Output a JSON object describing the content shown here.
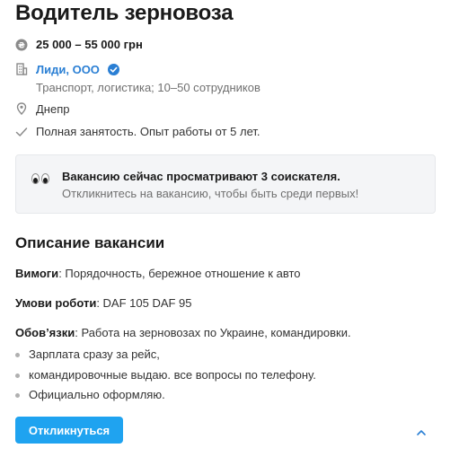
{
  "vacancy": {
    "title": "Водитель зерновоза",
    "salary": "25 000 – 55 000 грн",
    "company_name": "Лиди, ООО",
    "company_info": "Транспорт, логистика; 10–50 сотрудников",
    "city": "Днепр",
    "employment": "Полная занятость. Опыт работы от 5 лет."
  },
  "banner": {
    "title": "Вакансию сейчас просматривают 3 соискателя.",
    "subtitle": "Откликнитесь на вакансию, чтобы быть среди первых!"
  },
  "description": {
    "heading": "Описание вакансии",
    "requirements_label": "Вимоги",
    "requirements_text": ": Порядочность, бережное отношение к авто",
    "conditions_label": "Умови роботи",
    "conditions_text": ": DAF 105 DAF 95",
    "duties_label": "Обов’язки",
    "duties_text": ": Работа на зерновозах по Украине, командировки.",
    "bullets": [
      "Зарплата сразу за рейс,",
      "командировочные выдаю. все вопросы по телефону.",
      "Официально оформляю."
    ]
  },
  "actions": {
    "apply_label": "Откликнуться"
  },
  "icons": {
    "salary": "currency-coin-icon",
    "company": "building-icon",
    "verified": "verified-check-icon",
    "location": "location-pin-icon",
    "employment": "checkmark-icon",
    "eyes": "eyes-icon",
    "collapse": "chevron-up-icon"
  },
  "colors": {
    "link": "#2a7fd4",
    "button": "#1fa3f0",
    "banner_bg": "#f4f5f7"
  }
}
